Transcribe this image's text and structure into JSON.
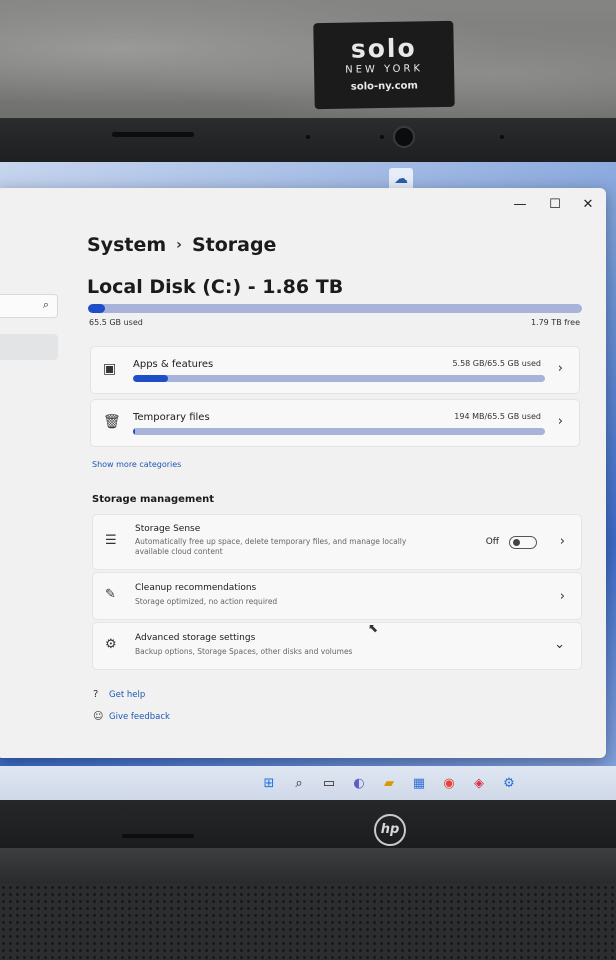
{
  "scene": {
    "tag": {
      "brand": "solo",
      "subtitle": "NEW YORK",
      "url": "solo-ny.com"
    },
    "laptop_logo": "hp"
  },
  "window": {
    "controls": {
      "minimize": "—",
      "maximize": "☐",
      "close": "✕"
    },
    "sidebar": {
      "search_icon": "search-icon"
    }
  },
  "header": {
    "breadcrumb_root": "System",
    "breadcrumb_sep": "›",
    "breadcrumb_current": "Storage"
  },
  "disk": {
    "title": "Local Disk (C:) - 1.86 TB",
    "used_label": "65.5 GB used",
    "free_label": "1.79 TB free",
    "used_fraction": 0.034
  },
  "categories": [
    {
      "title": "Apps & features",
      "size": "5.58 GB/65.5 GB used",
      "fraction": 0.085,
      "icon": "apps-icon"
    },
    {
      "title": "Temporary files",
      "size": "194 MB/65.5 GB used",
      "fraction": 0.003,
      "icon": "trash-icon"
    }
  ],
  "show_more": "Show more categories",
  "management": {
    "section_title": "Storage management",
    "storage_sense": {
      "title": "Storage Sense",
      "desc": "Automatically free up space, delete temporary files, and manage locally available cloud content",
      "toggle_label": "Off",
      "toggle_on": false
    },
    "cleanup": {
      "title": "Cleanup recommendations",
      "desc": "Storage optimized, no action required"
    },
    "advanced": {
      "title": "Advanced storage settings",
      "desc": "Backup options, Storage Spaces, other disks and volumes"
    }
  },
  "help": {
    "get_help": "Get help",
    "feedback": "Give feedback"
  },
  "colors": {
    "accent": "#1f4fc8",
    "bar_track": "#a7b3d8",
    "link": "#1f56b3"
  }
}
